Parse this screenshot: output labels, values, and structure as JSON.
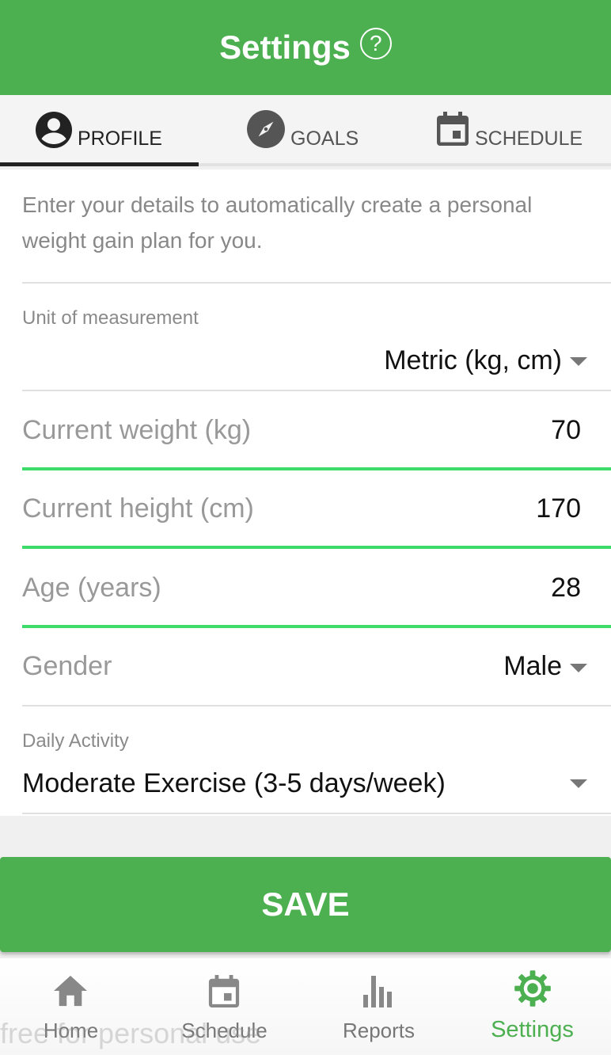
{
  "header": {
    "title": "Settings",
    "help_glyph": "?"
  },
  "tabs": [
    {
      "label": "PROFILE",
      "icon": "account-circle-icon",
      "active": true
    },
    {
      "label": "GOALS",
      "icon": "compass-icon",
      "active": false
    },
    {
      "label": "SCHEDULE",
      "icon": "calendar-icon",
      "active": false
    }
  ],
  "profile": {
    "intro": "Enter your details to automatically create a personal weight gain plan for you.",
    "unit": {
      "label": "Unit of measurement",
      "value": "Metric (kg, cm)"
    },
    "weight": {
      "label": "Current weight (kg)",
      "value": "70"
    },
    "height": {
      "label": "Current height (cm)",
      "value": "170"
    },
    "age": {
      "label": "Age (years)",
      "value": "28"
    },
    "gender": {
      "label": "Gender",
      "value": "Male"
    },
    "activity": {
      "label": "Daily Activity",
      "value": "Moderate Exercise (3-5 days/week)"
    }
  },
  "save_label": "SAVE",
  "nav": [
    {
      "label": "Home",
      "icon": "home-icon",
      "active": false
    },
    {
      "label": "Schedule",
      "icon": "calendar-icon",
      "active": false
    },
    {
      "label": "Reports",
      "icon": "bar-chart-icon",
      "active": false
    },
    {
      "label": "Settings",
      "icon": "settings-gear-icon",
      "active": true
    }
  ],
  "watermark": "free for personal use",
  "colors": {
    "primary": "#4caf50",
    "field_underline": "#3ddc6a"
  }
}
